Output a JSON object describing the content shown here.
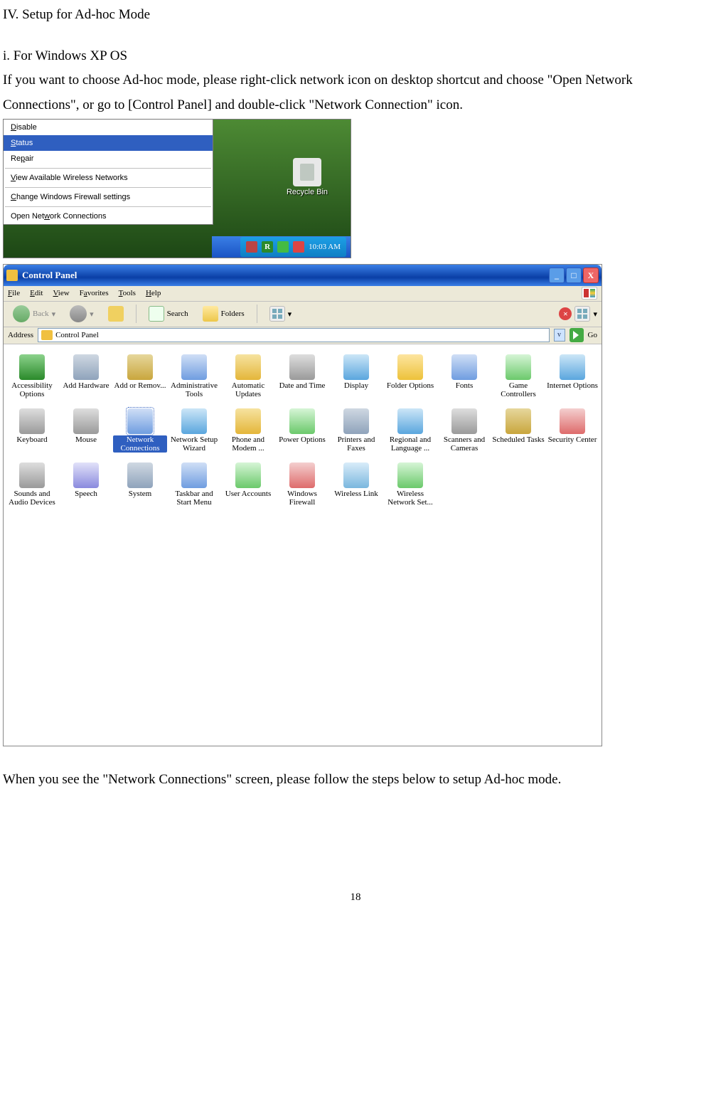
{
  "doc": {
    "heading": "IV. Setup for Ad-hoc Mode",
    "sub": "i. For Windows XP OS",
    "p1": "If you want to choose Ad-hoc mode, please right-click network icon on desktop shortcut and choose \"Open Network Connections\", or go to [Control Panel] and double-click \"Network Connection\" icon.",
    "p2": "When you see the \"Network Connections\" screen, please follow the steps below to setup Ad-hoc mode.",
    "page_num": "18"
  },
  "ctx": {
    "items": [
      {
        "pre": "",
        "u": "D",
        "post": "isable",
        "sel": false
      },
      {
        "pre": "",
        "u": "S",
        "post": "tatus",
        "sel": true
      },
      {
        "pre": "Re",
        "u": "p",
        "post": "air",
        "sel": false
      }
    ],
    "items2": [
      {
        "pre": "",
        "u": "V",
        "post": "iew Available Wireless Networks",
        "sel": false
      }
    ],
    "items3": [
      {
        "pre": "",
        "u": "C",
        "post": "hange Windows Firewall settings",
        "sel": false
      }
    ],
    "items4": [
      {
        "pre": "Open Net",
        "u": "w",
        "post": "ork Connections",
        "sel": false
      }
    ],
    "recycle": "Recycle Bin",
    "tray_r": "R",
    "clock": "10:03 AM"
  },
  "cp": {
    "title": "Control Panel",
    "menu": {
      "file": "File",
      "edit": "Edit",
      "view": "View",
      "fav": "Favorites",
      "tools": "Tools",
      "help": "Help"
    },
    "menu_u": {
      "file": "F",
      "edit": "E",
      "view": "V",
      "fav": "a",
      "tools": "T",
      "help": "H"
    },
    "tb": {
      "back": "Back",
      "search": "Search",
      "folders": "Folders"
    },
    "addr_label": "Address",
    "addr_value": "Control Panel",
    "go": "Go",
    "minus": "_",
    "square": "□",
    "x": "X",
    "icons": [
      {
        "label": "Accessibility Options",
        "bg": "bg0"
      },
      {
        "label": "Add Hardware",
        "bg": "bg1"
      },
      {
        "label": "Add or Remov...",
        "bg": "bg2"
      },
      {
        "label": "Administrative Tools",
        "bg": "bg3"
      },
      {
        "label": "Automatic Updates",
        "bg": "bg4"
      },
      {
        "label": "Date and Time",
        "bg": "bg5"
      },
      {
        "label": "Display",
        "bg": "bg6"
      },
      {
        "label": "Folder Options",
        "bg": "bg7"
      },
      {
        "label": "Fonts",
        "bg": "bg3"
      },
      {
        "label": "Game Controllers",
        "bg": "bg8"
      },
      {
        "label": "Internet Options",
        "bg": "bg6"
      },
      {
        "label": "Keyboard",
        "bg": "bg5"
      },
      {
        "label": "Mouse",
        "bg": "bg5"
      },
      {
        "label": "Network Connections",
        "bg": "bg3",
        "sel": true
      },
      {
        "label": "Network Setup Wizard",
        "bg": "bg6"
      },
      {
        "label": "Phone and Modem ...",
        "bg": "bg4"
      },
      {
        "label": "Power Options",
        "bg": "bg8"
      },
      {
        "label": "Printers and Faxes",
        "bg": "bg1"
      },
      {
        "label": "Regional and Language ...",
        "bg": "bg6"
      },
      {
        "label": "Scanners and Cameras",
        "bg": "bg5"
      },
      {
        "label": "Scheduled Tasks",
        "bg": "bg2"
      },
      {
        "label": "Security Center",
        "bg": "bg10"
      },
      {
        "label": "Sounds and Audio Devices",
        "bg": "bg5"
      },
      {
        "label": "Speech",
        "bg": "bg9"
      },
      {
        "label": "System",
        "bg": "bg1"
      },
      {
        "label": "Taskbar and Start Menu",
        "bg": "bg3"
      },
      {
        "label": "User Accounts",
        "bg": "bg8"
      },
      {
        "label": "Windows Firewall",
        "bg": "bg10"
      },
      {
        "label": "Wireless Link",
        "bg": "bg11"
      },
      {
        "label": "Wireless Network Set...",
        "bg": "bg8"
      }
    ]
  }
}
